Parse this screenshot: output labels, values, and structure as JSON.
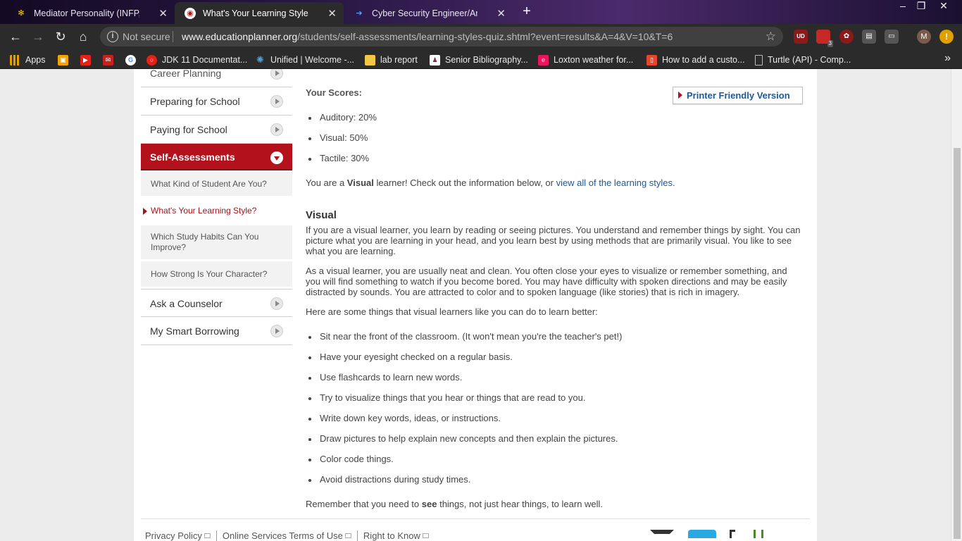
{
  "browser": {
    "tabs": [
      {
        "label": "Mediator Personality (INFP, -A/-T",
        "active": false
      },
      {
        "label": "What's Your Learning Style? The",
        "active": true
      },
      {
        "label": "Cyber Security Engineer/Architec",
        "active": false
      }
    ],
    "new_tab": "+",
    "window_controls": {
      "minimize": "–",
      "restore": "❐",
      "close": "✕"
    },
    "security_label": "Not secure",
    "url_domain": "www.educationplanner.org",
    "url_path": "/students/self-assessments/learning-styles-quiz.shtml?event=results&A=4&V=10&T=6",
    "extensions": [
      {
        "label": "UD",
        "color": "#8b1a1a"
      },
      {
        "label": "3",
        "color": "#c62828"
      },
      {
        "label": "✿",
        "color": "#8b1a1a"
      },
      {
        "label": "▤",
        "color": "#555555"
      },
      {
        "label": "▭",
        "color": "#555555"
      },
      {
        "label": "M",
        "color": "#7a5a4a"
      },
      {
        "label": "!",
        "color": "#e0a000"
      }
    ],
    "bookmarks": [
      {
        "label": "Apps",
        "color": "#e0a000"
      },
      {
        "label": "",
        "color": "#f6a300"
      },
      {
        "label": "",
        "color": "#e62117"
      },
      {
        "label": "",
        "color": "#c5221f"
      },
      {
        "label": "",
        "color": "#4285f4"
      },
      {
        "label": "JDK 11 Documentat...",
        "color": "#e62117"
      },
      {
        "label": "Unified | Welcome -...",
        "color": "#4aa3df"
      },
      {
        "label": "lab report",
        "color": "#f2c744"
      },
      {
        "label": "Senior Bibliography...",
        "color": "#8b2252"
      },
      {
        "label": "Loxton weather for...",
        "color": "#e8175d"
      },
      {
        "label": "How to add a custo...",
        "color": "#e8462b"
      },
      {
        "label": "Turtle (API) - Comp...",
        "color": "#9e9e9e"
      }
    ],
    "bookmarks_more": "»"
  },
  "sidebar": {
    "items": [
      {
        "label": "Career Planning"
      },
      {
        "label": "Preparing for School"
      },
      {
        "label": "Paying for School"
      },
      {
        "label": "Self-Assessments"
      },
      {
        "label": "Ask a Counselor"
      },
      {
        "label": "My Smart Borrowing"
      }
    ],
    "subitems": [
      {
        "label": "What Kind of Student Are You?"
      },
      {
        "label": "What's Your Learning Style?"
      },
      {
        "label": "Which Study Habits Can You Improve?"
      },
      {
        "label": "How Strong Is Your Character?"
      }
    ]
  },
  "main": {
    "scores_heading": "Your Scores:",
    "printer_link": "Printer Friendly Version",
    "scores": [
      {
        "label": "Auditory: 20%"
      },
      {
        "label": "Visual: 50%"
      },
      {
        "label": "Tactile: 30%"
      }
    ],
    "result_prefix": "You are a ",
    "result_style": "Visual",
    "result_middle": " learner! Check out the information below, or ",
    "result_link": "view all of the learning styles",
    "result_end": ".",
    "style_heading": "Visual",
    "para1": "If you are a visual learner, you learn by reading or seeing pictures. You understand and remember things by sight. You can picture what you are learning in your head, and you learn best by using methods that are primarily visual. You like to see what you are learning.",
    "para2": "As a visual learner, you are usually neat and clean. You often close your eyes to visualize or remember something, and you will find something to watch if you become bored. You may have difficulty with spoken directions and may be easily distracted by sounds. You are attracted to color and to spoken language (like stories) that is rich in imagery.",
    "tips_intro": "Here are some things that visual learners like you can do to learn better:",
    "tips": [
      {
        "text": "Sit near the front of the classroom. (It won't mean you're the teacher's pet!)"
      },
      {
        "text": "Have your eyesight checked on a regular basis."
      },
      {
        "text": "Use flashcards to learn new words."
      },
      {
        "text": "Try to visualize things that you hear or things that are read to you."
      },
      {
        "text": "Write down key words, ideas, or instructions."
      },
      {
        "text": "Draw pictures to help explain new concepts and then explain the pictures."
      },
      {
        "text": "Color code things."
      },
      {
        "text": "Avoid distractions during study times."
      }
    ],
    "closing_prefix": "Remember that you need to ",
    "closing_bold": "see",
    "closing_suffix": " things, not just hear things, to learn well."
  },
  "footer": {
    "links": [
      {
        "label": "Privacy Policy"
      },
      {
        "label": "Online Services Terms of Use"
      },
      {
        "label": "Right to Know"
      }
    ]
  },
  "colors": {
    "accent_red": "#b3111c",
    "link_blue": "#1a5a9a"
  }
}
